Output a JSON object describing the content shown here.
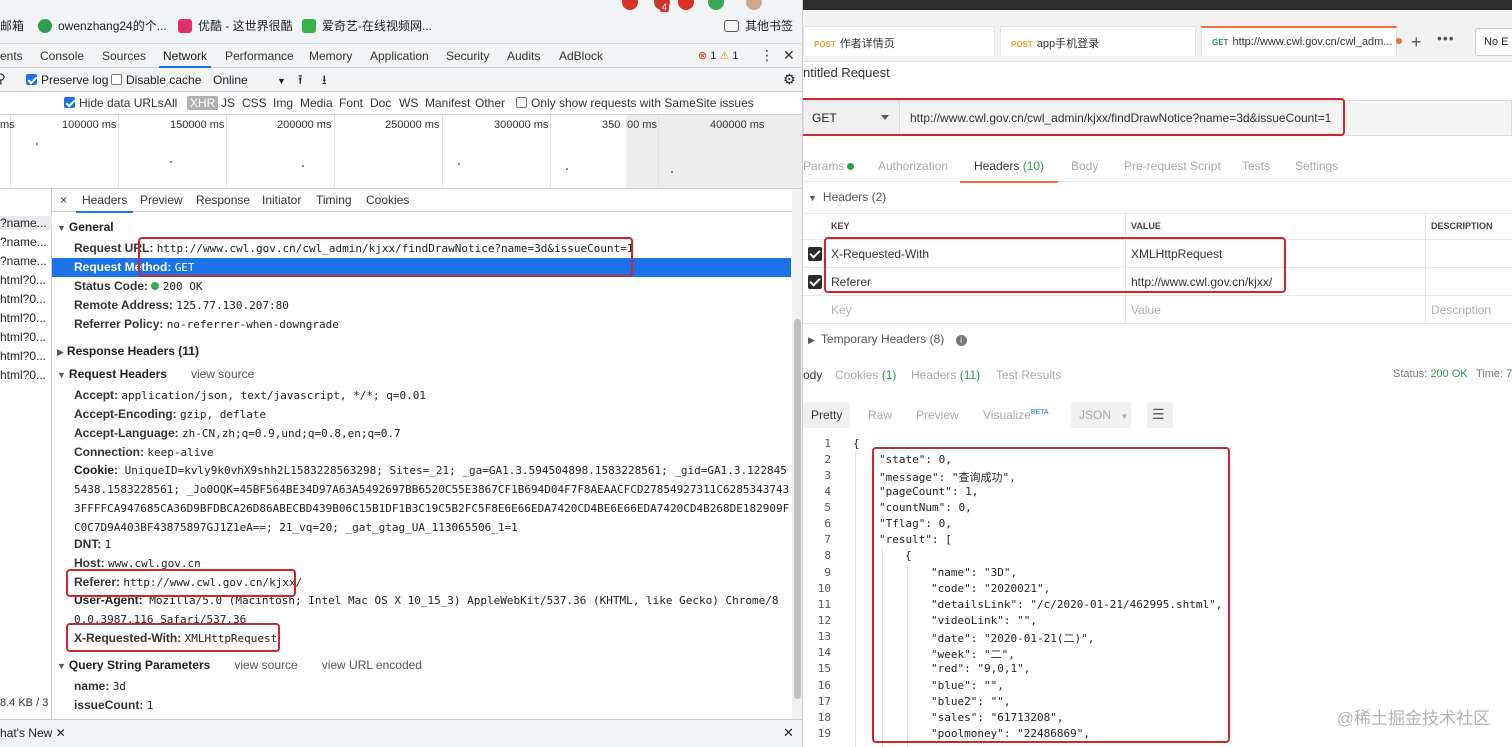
{
  "bookmarks": {
    "items": [
      "邮箱",
      "owenzhang24的个...",
      "优酷 - 这世界很酷",
      "爱奇艺-在线视频网..."
    ],
    "other": "其他书签",
    "ext_badge": "4"
  },
  "devtools": {
    "tabs": [
      "ents",
      "Console",
      "Sources",
      "Network",
      "Performance",
      "Memory",
      "Application",
      "Security",
      "Audits",
      "AdBlock"
    ],
    "active_tab": "Network",
    "errors": "1",
    "warnings": "1",
    "toolbar": {
      "preserve_log": "Preserve log",
      "disable_cache": "Disable cache",
      "throttle": "Online"
    },
    "filters": {
      "hide_data_urls": "Hide data URLs",
      "types": [
        "All",
        "XHR",
        "JS",
        "CSS",
        "Img",
        "Media",
        "Font",
        "Doc",
        "WS",
        "Manifest",
        "Other"
      ],
      "active_type": "XHR",
      "samesite": "Only show requests with SameSite issues"
    },
    "timeline_labels": [
      "ms",
      "100000 ms",
      "150000 ms",
      "200000 ms",
      "250000 ms",
      "300000 ms",
      "350",
      "00 ms",
      "400000 ms"
    ],
    "requests": [
      "?name...",
      "?name...",
      "?name...",
      "html?0...",
      "html?0...",
      "html?0...",
      "html?0...",
      "html?0...",
      "html?0..."
    ],
    "transfer_footer": "8.4 KB / 3",
    "detail_tabs": [
      "×",
      "Headers",
      "Preview",
      "Response",
      "Initiator",
      "Timing",
      "Cookies"
    ],
    "general": {
      "title": "General",
      "request_url_label": "Request URL:",
      "request_url": "http://www.cwl.gov.cn/cwl_admin/kjxx/findDrawNotice?name=3d&issueCount=1",
      "method_label": "Request Method:",
      "method": "GET",
      "status_label": "Status Code:",
      "status": "200 OK",
      "remote_label": "Remote Address:",
      "remote": "125.77.130.207:80",
      "referrer_policy_label": "Referrer Policy:",
      "referrer_policy": "no-referrer-when-downgrade"
    },
    "response_headers": {
      "title": "Response Headers (11)"
    },
    "request_headers": {
      "title": "Request Headers",
      "view_source": "view source",
      "accept_label": "Accept:",
      "accept": "application/json, text/javascript, */*; q=0.01",
      "accept_encoding_label": "Accept-Encoding:",
      "accept_encoding": "gzip, deflate",
      "accept_language_label": "Accept-Language:",
      "accept_language": "zh-CN,zh;q=0.9,und;q=0.8,en;q=0.7",
      "connection_label": "Connection:",
      "connection": "keep-alive",
      "cookie_label": "Cookie:",
      "cookie": "UniqueID=kvly9k0vhX9shh2L1583228563298; Sites=_21; _ga=GA1.3.594504898.1583228561; _gid=GA1.3.1228455438.1583228561; _Jo0OQK=45BF564BE34D97A63A5492697BB6520C55E3867CF1B694D04F7F8AEAACFCD27854927311C62853437433FFFFCA947685CA36D9BFDBCA26D86ABECBD439B06C15B1DF1B3C19C5B2FC5F8E6E66EDA7420CD4BE6E66EDA7420CD4B268DE182909FC0C7D9A403BF43875897GJ1Z1eA==; 21_vq=20; _gat_gtag_UA_113065506_1=1",
      "dnt_label": "DNT:",
      "dnt": "1",
      "host_label": "Host:",
      "host": "www.cwl.gov.cn",
      "referer_label": "Referer:",
      "referer": "http://www.cwl.gov.cn/kjxx/",
      "ua_label": "User-Agent:",
      "ua": "Mozilla/5.0 (Macintosh; Intel Mac OS X 10_15_3) AppleWebKit/537.36 (KHTML, like Gecko) Chrome/80.0.3987.116 Safari/537.36",
      "xrw_label": "X-Requested-With:",
      "xrw": "XMLHttpRequest"
    },
    "query_params": {
      "title": "Query String Parameters",
      "view_source": "view source",
      "view_url_encoded": "view URL encoded",
      "name_label": "name:",
      "name": "3d",
      "issue_label": "issueCount:",
      "issue": "1"
    },
    "drawer_tab": "hat's New"
  },
  "postman": {
    "tabs": [
      {
        "method": "POST",
        "label": "作者详情页"
      },
      {
        "method": "POST",
        "label": "app手机登录"
      },
      {
        "method": "GET",
        "label": "http://www.cwl.gov.cn/cwl_adm..."
      }
    ],
    "env": "No E",
    "title": "ntitled Request",
    "method": "GET",
    "url": "http://www.cwl.gov.cn/cwl_admin/kjxx/findDrawNotice?name=3d&issueCount=1",
    "req_tabs": {
      "params": "Params",
      "authorization": "Authorization",
      "headers": "Headers",
      "headers_count": "(10)",
      "body": "Body",
      "prerequest": "Pre-request Script",
      "tests": "Tests",
      "settings": "Settings"
    },
    "headers_section": "Headers (2)",
    "table": {
      "key_col": "KEY",
      "value_col": "VALUE",
      "desc_col": "DESCRIPTION",
      "rows": [
        {
          "key": "X-Requested-With",
          "value": "XMLHttpRequest"
        },
        {
          "key": "Referer",
          "value": "http://www.cwl.gov.cn/kjxx/"
        }
      ],
      "key_placeholder": "Key",
      "value_placeholder": "Value",
      "desc_placeholder": "Description"
    },
    "temp_headers": "Temporary Headers (8)",
    "resp_tabs": {
      "body": "ody",
      "cookies": "Cookies",
      "cookies_count": "(1)",
      "headers": "Headers",
      "headers_count": "(11)",
      "test_results": "Test Results"
    },
    "status_label": "Status:",
    "status": "200 OK",
    "time_label": "Time:",
    "time": "7",
    "formats": {
      "pretty": "Pretty",
      "raw": "Raw",
      "preview": "Preview",
      "visualize": "Visualize",
      "beta": "BETA",
      "json": "JSON"
    },
    "code_lines": [
      "{",
      "\"state\": 0,",
      "\"message\": \"查询成功\",",
      "\"pageCount\": 1,",
      "\"countNum\": 0,",
      "\"Tflag\": 0,",
      "\"result\": [",
      "{",
      "\"name\": \"3D\",",
      "\"code\": \"2020021\",",
      "\"detailsLink\": \"/c/2020-01-21/462995.shtml\",",
      "\"videoLink\": \"\",",
      "\"date\": \"2020-01-21(二)\",",
      "\"week\": \"二\",",
      "\"red\": \"9,0,1\",",
      "\"blue\": \"\",",
      "\"blue2\": \"\",",
      "\"sales\": \"61713208\",",
      "\"poolmoney\": \"22486869\","
    ]
  },
  "watermark": "@稀土掘金技术社区"
}
